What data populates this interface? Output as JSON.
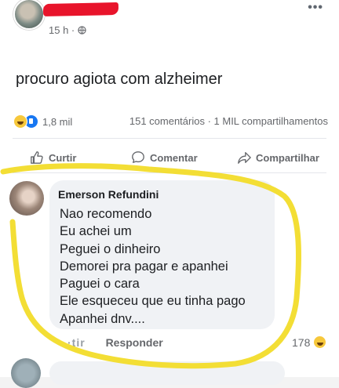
{
  "post": {
    "author_name_redacted": true,
    "time": "15 h ·",
    "text": "procuro agiota com alzheimer"
  },
  "stats": {
    "reactions_count": "1,8 mil",
    "comments_shares": "151 comentários · 1 MIL compartilhamentos"
  },
  "actions": {
    "like": "Curtir",
    "comment": "Comentar",
    "share": "Compartilhar"
  },
  "comment": {
    "author": "Emerson Refundini",
    "lines": [
      "Nao recomendo",
      "Eu achei um",
      "Peguei o dinheiro",
      "Demorei pra pagar e apanhei",
      "Paguei o cara",
      "Ele esqueceu que eu tinha pago",
      "Apanhei dnv...."
    ],
    "like_label": "·tir",
    "reply_label": "Responder",
    "reaction_count": "178"
  },
  "colors": {
    "redaction": "#e8142b",
    "marker": "#f2dc2a",
    "like_blue": "#1877f2",
    "haha_yellow": "#f7c83b"
  },
  "icons": [
    "globe-icon",
    "more-icon",
    "like-icon",
    "comment-icon",
    "share-icon",
    "haha-emoji-icon",
    "like-emoji-icon"
  ]
}
